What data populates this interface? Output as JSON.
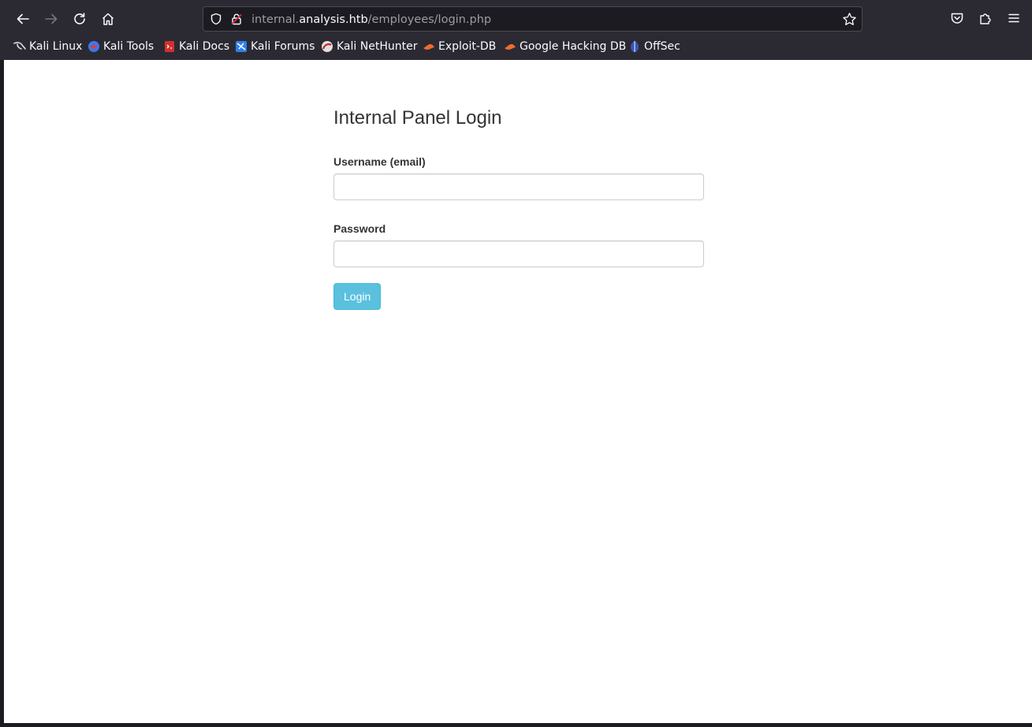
{
  "browser": {
    "url_prefix": "internal.",
    "url_host": "analysis.htb",
    "url_path": "/employees/login.php",
    "bookmarks": [
      {
        "label": "Kali Linux",
        "icon": "kali-dragon-icon"
      },
      {
        "label": "Kali Tools",
        "icon": "kali-tools-icon"
      },
      {
        "label": "Kali Docs",
        "icon": "kali-docs-icon"
      },
      {
        "label": "Kali Forums",
        "icon": "kali-forums-icon"
      },
      {
        "label": "Kali NetHunter",
        "icon": "kali-nethunter-icon"
      },
      {
        "label": "Exploit-DB",
        "icon": "exploit-db-icon"
      },
      {
        "label": "Google Hacking DB",
        "icon": "ghdb-icon"
      },
      {
        "label": "OffSec",
        "icon": "offsec-icon"
      }
    ]
  },
  "login": {
    "title": "Internal Panel Login",
    "username_label": "Username (email)",
    "username_value": "",
    "password_label": "Password",
    "password_value": "",
    "submit_label": "Login"
  },
  "colors": {
    "chrome_bg": "#2b2a33",
    "urlbar_bg": "#1c1b22",
    "button_bg": "#5bc0de",
    "page_bg": "#ffffff"
  }
}
